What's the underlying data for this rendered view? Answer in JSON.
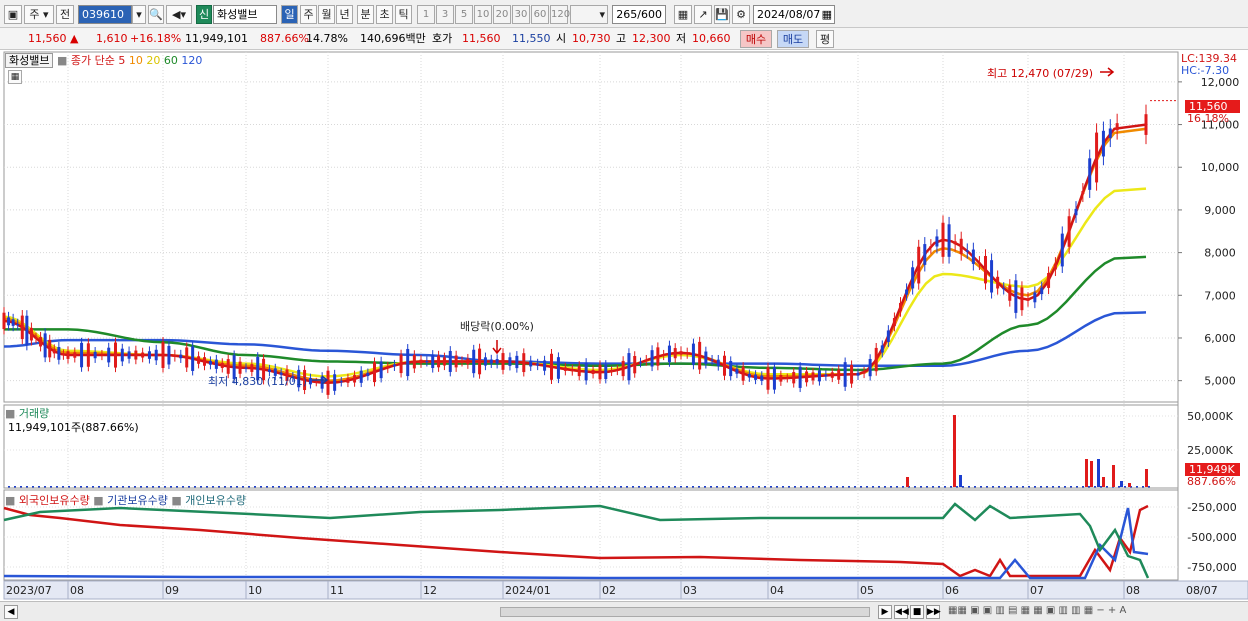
{
  "toolbar": {
    "period_select": "주",
    "prev_label": "전",
    "code": "039610",
    "market_badge": "신",
    "stock_name": "화성밸브",
    "periods": [
      "일",
      "주",
      "월",
      "년",
      "분",
      "초",
      "틱"
    ],
    "numbers": [
      "1",
      "3",
      "5",
      "10",
      "20",
      "30",
      "60",
      "120"
    ],
    "count": "265",
    "count_total": "/600",
    "date": "2024/08/07"
  },
  "quote": {
    "price": "11,560",
    "change": "1,610",
    "change_pct": "+16.18%",
    "volume": "11,949,101",
    "volume_ratio": "887.66%",
    "turnover": "14.78%",
    "amount": "140,696백만",
    "hoga_label": "호가",
    "ask": "11,560",
    "bid": "11,550",
    "open_label": "시",
    "open": "10,730",
    "high_label": "고",
    "high": "12,300",
    "low_label": "저",
    "low": "10,660",
    "buy_btn": "매수",
    "sell_btn": "매도",
    "avg_btn": "평"
  },
  "price_panel": {
    "name": "화성밸브",
    "ma_label": "종가 단순",
    "ma_periods": [
      "5",
      "10",
      "20",
      "60",
      "120"
    ],
    "ma_colors": [
      "#d01515",
      "#f08a00",
      "#ece818",
      "#1f8a2a",
      "#2a56d6"
    ],
    "lc": "LC:139.34",
    "hc": "HC:-7.30",
    "current_tag": "11,560",
    "current_pct": "16.18%",
    "y_ticks": [
      "12,000",
      "11,000",
      "10,000",
      "9,000",
      "8,000",
      "7,000",
      "6,000",
      "5,000"
    ],
    "annot_high": "최고 12,470 (07/29)",
    "annot_low": "최저 4,830 (11/01)",
    "annot_dividend": "배당락(0.00%)"
  },
  "volume_panel": {
    "title": "거래량",
    "value": "11,949,101주(887.66%)",
    "y_ticks": [
      "50,000K",
      "25,000K"
    ],
    "current_tag": "11,949K",
    "current_pct": "887.66%"
  },
  "holdings_panel": {
    "labels": [
      "외국인보유수량",
      "기관보유수량",
      "개인보유수량"
    ],
    "colors": [
      "#d01515",
      "#2a56d6",
      "#1f8a5a"
    ],
    "y_ticks": [
      "-250,000",
      "-500,000",
      "-750,000"
    ]
  },
  "x_axis": [
    "2023/07",
    "08",
    "09",
    "10",
    "11",
    "12",
    "2024/01",
    "02",
    "03",
    "04",
    "05",
    "06",
    "07",
    "08"
  ],
  "x_axis_right": "08/07",
  "chart_data": {
    "type": "line",
    "title": "화성밸브",
    "x": [
      "2023/07",
      "2023/08",
      "2023/09",
      "2023/10",
      "2023/11",
      "2023/12",
      "2024/01",
      "2024/02",
      "2024/03",
      "2024/04",
      "2024/05",
      "2024/06",
      "2024/07",
      "2024/08"
    ],
    "series": [
      {
        "name": "5",
        "values": [
          6400,
          5600,
          5600,
          5300,
          4950,
          5450,
          5450,
          5200,
          5650,
          5050,
          5150,
          8300,
          6900,
          11000
        ]
      },
      {
        "name": "10",
        "values": [
          6450,
          5650,
          5600,
          5350,
          5000,
          5450,
          5450,
          5200,
          5650,
          5100,
          5150,
          8100,
          7000,
          10900
        ]
      },
      {
        "name": "20",
        "values": [
          6500,
          5700,
          5600,
          5400,
          5100,
          5450,
          5450,
          5250,
          5600,
          5150,
          5150,
          7500,
          7200,
          9500
        ]
      },
      {
        "name": "60",
        "values": [
          6200,
          6200,
          5900,
          5600,
          5450,
          5400,
          5400,
          5350,
          5400,
          5300,
          5250,
          5400,
          6300,
          7900
        ]
      },
      {
        "name": "120",
        "values": [
          5800,
          5950,
          5950,
          5850,
          5700,
          5600,
          5450,
          5400,
          5400,
          5400,
          5350,
          5350,
          5700,
          6600
        ]
      }
    ],
    "ylim": [
      4500,
      12700
    ]
  }
}
